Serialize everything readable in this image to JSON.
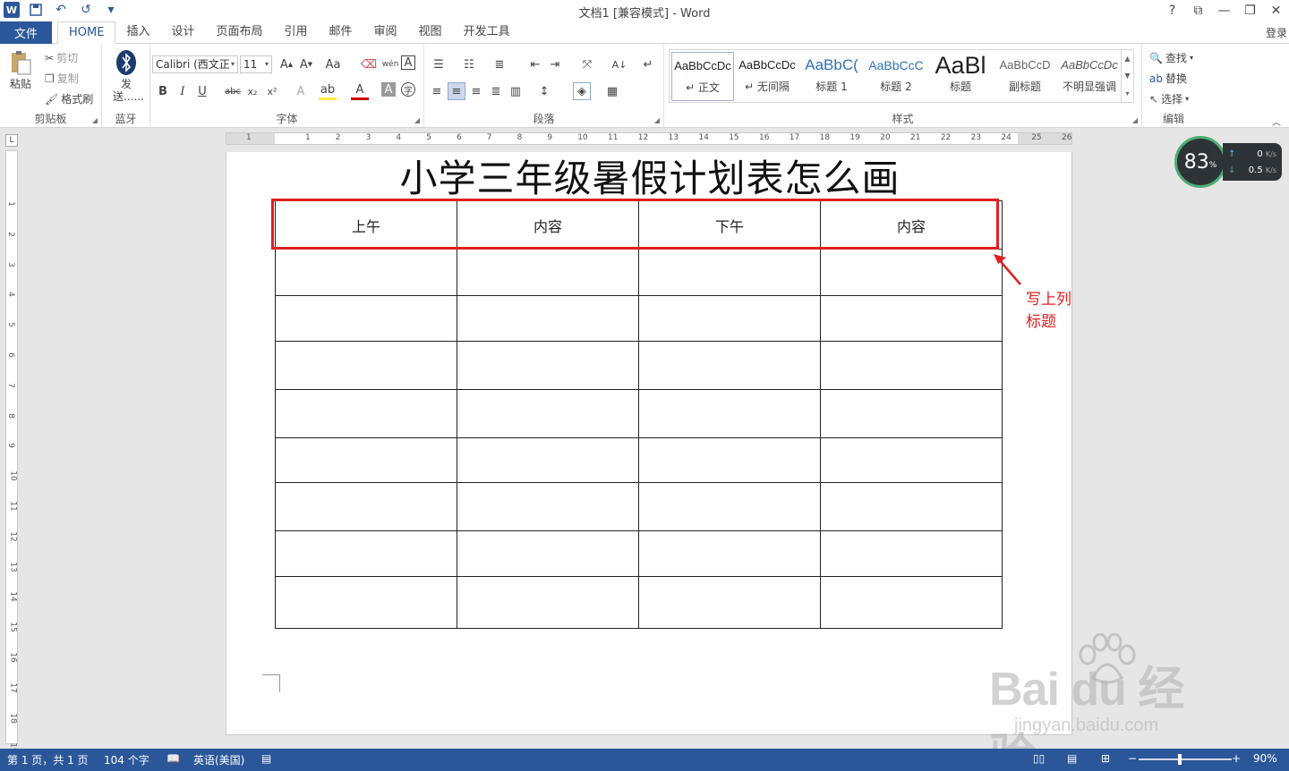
{
  "window": {
    "title": "文档1 [兼容模式] - Word",
    "controls": [
      "?",
      "⧉",
      "—",
      "❐",
      "✕"
    ]
  },
  "qat": {
    "logo": "W",
    "save_icon": "💾",
    "undo_icon": "↶",
    "redo_icon": "↺",
    "more_icon": "▾"
  },
  "tabs": {
    "file": "文件",
    "items": [
      "HOME",
      "插入",
      "设计",
      "页面布局",
      "引用",
      "邮件",
      "审阅",
      "视图",
      "开发工具"
    ],
    "login": "登录"
  },
  "ribbon": {
    "clipboard": {
      "label": "剪贴板",
      "paste": "粘贴",
      "cut": "剪切",
      "copy": "复制",
      "format_painter": "格式刷"
    },
    "bluetooth": {
      "label": "蓝牙",
      "send": "发送......"
    },
    "font": {
      "label": "字体",
      "font_name": "Calibri (西文正",
      "font_size": "11"
    },
    "paragraph": {
      "label": "段落"
    },
    "styles": {
      "label": "样式",
      "items": [
        {
          "preview": "AaBbCcDc",
          "name": "↵ 正文"
        },
        {
          "preview": "AaBbCcDc",
          "name": "↵ 无间隔"
        },
        {
          "preview": "AaBbC(",
          "name": "标题 1"
        },
        {
          "preview": "AaBbCcC",
          "name": "标题 2"
        },
        {
          "preview": "AaBl",
          "name": "标题"
        },
        {
          "preview": "AaBbCcD",
          "name": "副标题"
        },
        {
          "preview": "AaBbCcDc",
          "name": "不明显强调"
        }
      ]
    },
    "editing": {
      "label": "编辑",
      "find": "查找",
      "replace": "替换",
      "select": "选择"
    }
  },
  "ruler": {
    "h_numbers": [
      "1",
      "1",
      "2",
      "3",
      "4",
      "5",
      "6",
      "7",
      "8",
      "9",
      "10",
      "11",
      "12",
      "13",
      "14",
      "15",
      "16",
      "17",
      "18",
      "19",
      "20",
      "21",
      "22",
      "23",
      "24",
      "25",
      "26"
    ],
    "v_numbers": [
      "1",
      "2",
      "3",
      "4",
      "5",
      "6",
      "7",
      "8",
      "9",
      "10",
      "11",
      "12",
      "13",
      "14",
      "15",
      "16",
      "17",
      "18",
      "19"
    ],
    "corner": "L"
  },
  "document": {
    "heading": "小学三年级暑假计划表怎么画",
    "table": {
      "headers": [
        "上午",
        "内容",
        "下午",
        "内容"
      ],
      "row_heights": [
        52,
        51,
        54,
        54,
        50,
        54,
        51,
        58
      ]
    },
    "annotation": "写上列标题"
  },
  "speed_widget": {
    "percent": "83",
    "unit": "%",
    "up": "0",
    "down": "0.5",
    "rate_unit": "K/s"
  },
  "watermark": {
    "brand": "Bai du 经验",
    "url": "jingyan.baidu.com"
  },
  "status": {
    "page": "第 1 页，共 1 页",
    "words": "104 个字",
    "language": "英语(美国)",
    "zoom": "90%"
  }
}
